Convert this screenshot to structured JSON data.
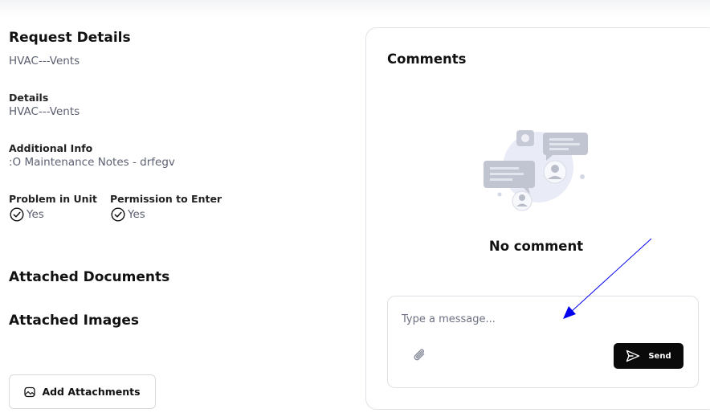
{
  "request": {
    "section_title": "Request Details",
    "title_value": "HVAC---Vents",
    "details_label": "Details",
    "details_value": "HVAC---Vents",
    "additional_info_label": "Additional Info",
    "additional_info_value": ":O Maintenance Notes - drfegv",
    "problem_in_unit_label": "Problem in Unit",
    "problem_in_unit_value": "Yes",
    "permission_label": "Permission to Enter",
    "permission_value": "Yes"
  },
  "attachments": {
    "documents_title": "Attached Documents",
    "images_title": "Attached Images",
    "add_button_label": "Add Attachments",
    "add_button_icon": "image-icon"
  },
  "comments": {
    "title": "Comments",
    "empty_text": "No comment",
    "empty_illustration": "chat-bubbles-illustration",
    "input_placeholder": "Type a message...",
    "input_value": "",
    "attach_icon": "paperclip-icon",
    "send_label": "Send",
    "send_icon": "send-icon"
  },
  "colors": {
    "send_button": "#0a0a0a",
    "value_text": "#5b6070",
    "annotation_arrow": "#0000ee"
  }
}
